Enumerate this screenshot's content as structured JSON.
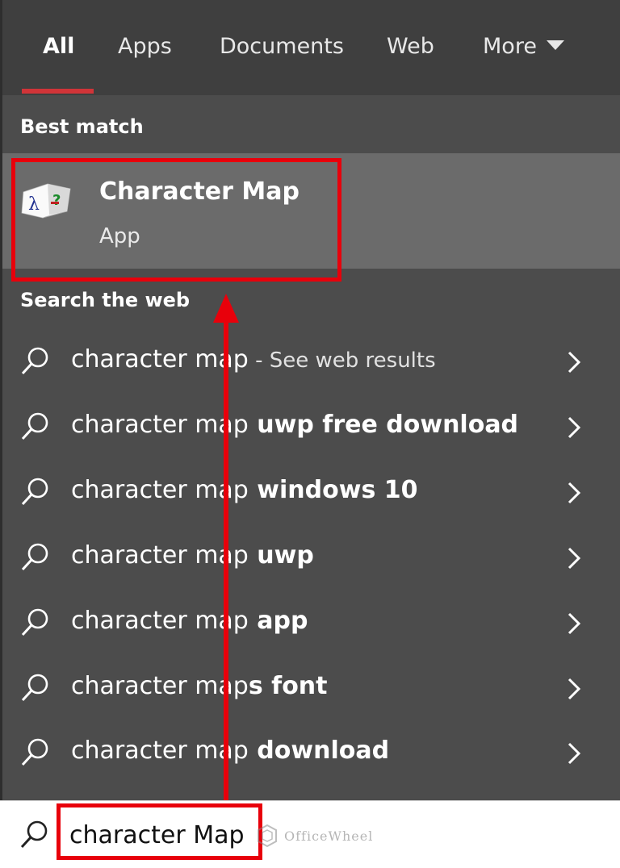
{
  "tabs": [
    {
      "label": "All",
      "active": true
    },
    {
      "label": "Apps",
      "active": false
    },
    {
      "label": "Documents",
      "active": false
    },
    {
      "label": "Web",
      "active": false
    },
    {
      "label": "More",
      "active": false
    }
  ],
  "best_match": {
    "title": "Best match",
    "app_name": "Character Map",
    "app_type": "App",
    "icon": "character-map-app-icon"
  },
  "web": {
    "title": "Search the web",
    "results": [
      {
        "query": "character map",
        "suffix": " - See web results",
        "suffix_style": "light"
      },
      {
        "query": "character map",
        "suffix": " uwp free download",
        "suffix_style": "bold"
      },
      {
        "query": "character map",
        "suffix": " windows 10",
        "suffix_style": "bold"
      },
      {
        "query": "character map",
        "suffix": " uwp",
        "suffix_style": "bold"
      },
      {
        "query": "character map",
        "suffix": " app",
        "suffix_style": "bold"
      },
      {
        "query": "character map",
        "suffix": "s font",
        "suffix_style": "bold"
      },
      {
        "query": "character map",
        "suffix": " download",
        "suffix_style": "bold"
      }
    ]
  },
  "search": {
    "value": "character Map",
    "icon": "search-icon"
  },
  "watermark": {
    "text": "OfficeWheel"
  },
  "colors": {
    "accent": "#d13438",
    "highlight": "#e8000b",
    "panel": "#4c4c4c",
    "best_row": "#6b6b6b"
  }
}
